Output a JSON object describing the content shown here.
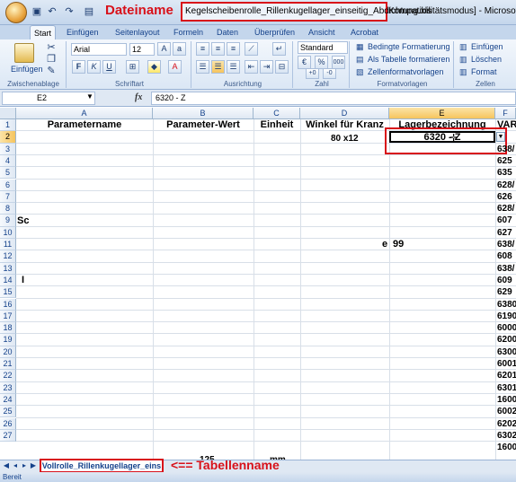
{
  "annotations": {
    "file_label": "Dateiname",
    "sheet_label": "<== Tabellenname"
  },
  "titlebar": {
    "filename": "Kegelscheibenrolle_Rillenkugellager_einseitig_Abdichtung.xls",
    "mode": "Kompatibilitätsmodus] - Microsoft Exc"
  },
  "tabs": [
    "Start",
    "Einfügen",
    "Seitenlayout",
    "Formeln",
    "Daten",
    "Überprüfen",
    "Ansicht",
    "Acrobat"
  ],
  "ribbon": {
    "paste_label": "Einfügen",
    "clipboard_group": "Zwischenablage",
    "font_name": "Arial",
    "font_size": "12",
    "font_group": "Schriftart",
    "alignment_group": "Ausrichtung",
    "number_format": "Standard",
    "number_group": "Zahl",
    "cond_format": "Bedingte Formatierung",
    "as_table": "Als Tabelle formatieren",
    "cell_styles": "Zellenformatvorlagen",
    "styles_group": "Formatvorlagen",
    "insert": "Einfügen",
    "delete": "Löschen",
    "format": "Format",
    "cells_group": "Zellen",
    "bold": "F",
    "italic": "K",
    "underline": "U"
  },
  "formula_bar": {
    "name_box": "E2",
    "fx": "fx",
    "formula": "6320 - Z"
  },
  "columns": [
    "A",
    "B",
    "C",
    "D",
    "E",
    "F"
  ],
  "header_row": {
    "a": "Parametername",
    "b": "Parameter-Wert",
    "c": "Einheit",
    "d": "Winkel für Kranz",
    "e": "Lagerbezeichnung",
    "f": "VAR"
  },
  "rows": [
    "1",
    "2",
    "3",
    "4",
    "5",
    "6",
    "7",
    "8",
    "9",
    "10",
    "11",
    "12",
    "13",
    "14",
    "15",
    "16",
    "17",
    "18",
    "19",
    "20",
    "21",
    "22",
    "23",
    "24",
    "25",
    "26",
    "27"
  ],
  "cells": {
    "d2": "80 x12",
    "e2": "6320 - Z",
    "a8": "Sc",
    "d10": "e",
    "e10": "99",
    "a13": "I",
    "bottom_b": "125",
    "bottom_c": "mm",
    "f_col": [
      "638/",
      "625",
      "635",
      "628/",
      "626",
      "628/",
      "607",
      "627",
      "638/",
      "608",
      "638/",
      "609",
      "629",
      "6380",
      "6190",
      "6000",
      "6200",
      "6300",
      "6001",
      "6201",
      "6301",
      "1600",
      "6002",
      "6202",
      "6302",
      "1600"
    ]
  },
  "sheet_tab": "Vollrolle_Rillenkugellager_eins",
  "status": "Bereit",
  "colors": {
    "annotation_red": "#d8111a",
    "ribbon_blue": "#15428b"
  }
}
